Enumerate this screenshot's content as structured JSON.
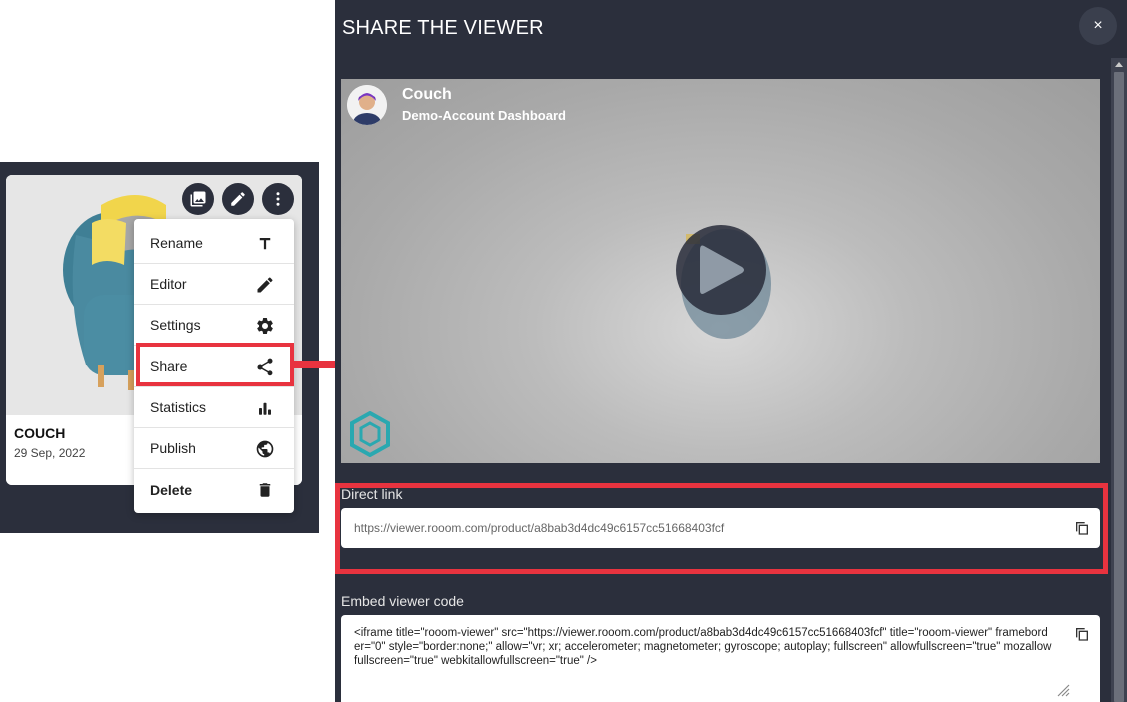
{
  "card": {
    "title": "COUCH",
    "date": "29 Sep, 2022",
    "buttons": [
      "image-icon",
      "pencil-icon",
      "more-vert-icon"
    ]
  },
  "menu": {
    "items": [
      {
        "label": "Rename",
        "icon": "text-icon"
      },
      {
        "label": "Editor",
        "icon": "pencil-icon"
      },
      {
        "label": "Settings",
        "icon": "gear-icon"
      },
      {
        "label": "Share",
        "icon": "share-icon"
      },
      {
        "label": "Statistics",
        "icon": "bar-chart-icon"
      },
      {
        "label": "Publish",
        "icon": "globe-icon"
      },
      {
        "label": "Delete",
        "icon": "trash-icon"
      }
    ]
  },
  "dialog": {
    "title": "SHARE THE VIEWER",
    "close_label": "×",
    "viewer": {
      "title": "Couch",
      "subtitle": "Demo-Account Dashboard"
    },
    "direct_link": {
      "label": "Direct link",
      "value": "https://viewer.rooom.com/product/a8bab3d4dc49c6157cc51668403fcf"
    },
    "embed": {
      "label": "Embed viewer code",
      "value": "<iframe title=\"rooom-viewer\" src=\"https://viewer.rooom.com/product/a8bab3d4dc49c6157cc51668403fcf\" title=\"rooom-viewer\" frameborder=\"0\" style=\"border:none;\" allow=\"vr; xr; accelerometer; magnetometer; gyroscope; autoplay; fullscreen\" allowfullscreen=\"true\" mozallowfullscreen=\"true\" webkitallowfullscreen=\"true\" />"
    }
  },
  "colors": {
    "panel": "#2b2f3c",
    "highlight": "#e8333f",
    "accent_teal": "#2aa8b0"
  }
}
